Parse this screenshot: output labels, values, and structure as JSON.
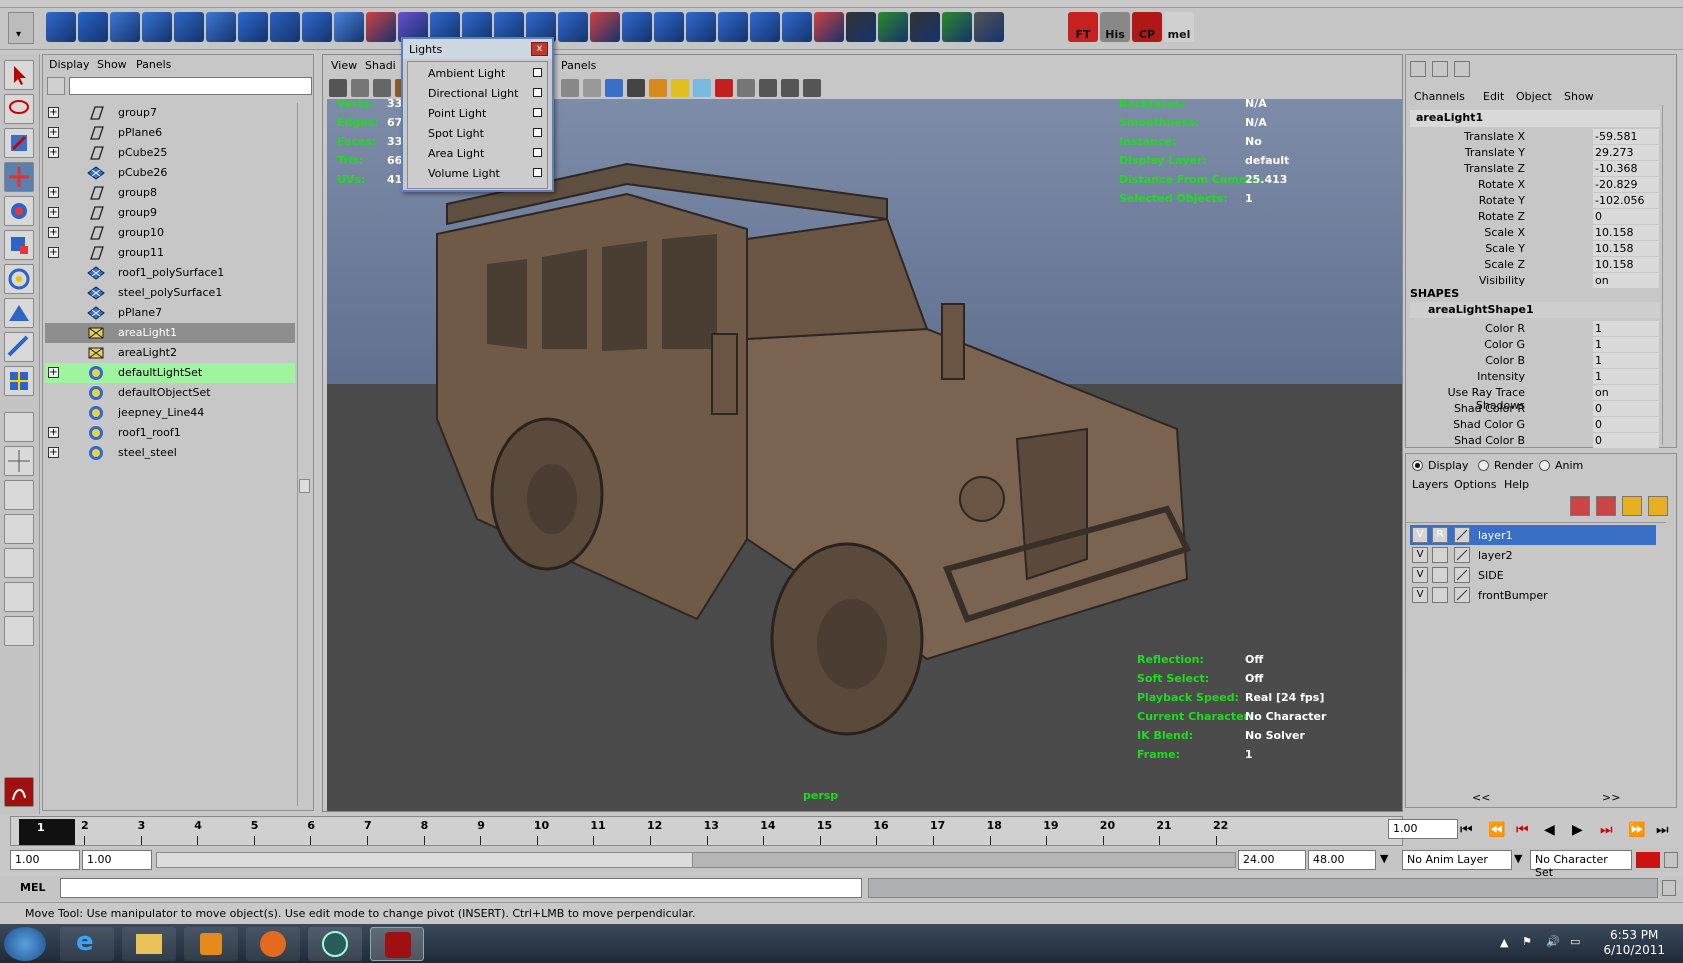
{
  "shelf": {
    "buttons": [
      {
        "label": "FT"
      },
      {
        "label": "His"
      },
      {
        "label": "CP"
      },
      {
        "label": "mel"
      }
    ]
  },
  "outliner": {
    "menu": [
      "Display",
      "Show",
      "Panels"
    ],
    "items": [
      {
        "name": "group7",
        "icon": "transform-icon",
        "expandable": true
      },
      {
        "name": "pPlane6",
        "icon": "transform-icon",
        "expandable": true
      },
      {
        "name": "pCube25",
        "icon": "transform-icon",
        "expandable": true
      },
      {
        "name": "pCube26",
        "icon": "mesh-icon",
        "expandable": false
      },
      {
        "name": "group8",
        "icon": "transform-icon",
        "expandable": true
      },
      {
        "name": "group9",
        "icon": "transform-icon",
        "expandable": true
      },
      {
        "name": "group10",
        "icon": "transform-icon",
        "expandable": true
      },
      {
        "name": "group11",
        "icon": "transform-icon",
        "expandable": true
      },
      {
        "name": "roof1_polySurface1",
        "icon": "mesh-icon",
        "expandable": false
      },
      {
        "name": "steel_polySurface1",
        "icon": "mesh-icon",
        "expandable": false
      },
      {
        "name": "pPlane7",
        "icon": "mesh-icon",
        "expandable": false
      },
      {
        "name": "areaLight1",
        "icon": "area-light-icon",
        "expandable": false,
        "state": "selected"
      },
      {
        "name": "areaLight2",
        "icon": "area-light-icon",
        "expandable": false
      },
      {
        "name": "defaultLightSet",
        "icon": "set-icon",
        "expandable": true,
        "state": "highlight"
      },
      {
        "name": "defaultObjectSet",
        "icon": "set-icon",
        "expandable": false
      },
      {
        "name": "jeepney_Line44",
        "icon": "set-icon",
        "expandable": false
      },
      {
        "name": "roof1_roof1",
        "icon": "set-icon",
        "expandable": true
      },
      {
        "name": "steel_steel",
        "icon": "set-icon",
        "expandable": true
      }
    ]
  },
  "viewport": {
    "menu": [
      "View",
      "Shadi",
      "Panels"
    ],
    "camera": "persp",
    "hud_top_left": [
      {
        "label": "Verts:",
        "value": "33"
      },
      {
        "label": "Edges:",
        "value": "67"
      },
      {
        "label": "Faces:",
        "value": "33"
      },
      {
        "label": "Tris:",
        "value": "66"
      },
      {
        "label": "UVs:",
        "value": "41"
      }
    ],
    "hud_top_right": [
      {
        "label": "Backfaces:",
        "value": "N/A"
      },
      {
        "label": "Smoothness:",
        "value": "N/A"
      },
      {
        "label": "Instance:",
        "value": "No"
      },
      {
        "label": "Display Layer:",
        "value": "default"
      },
      {
        "label": "Distance From Camera:",
        "value": "25.413"
      },
      {
        "label": "Selected Objects:",
        "value": "1"
      }
    ],
    "hud_bottom_right": [
      {
        "label": "Reflection:",
        "value": "Off"
      },
      {
        "label": "Soft Select:",
        "value": "Off"
      },
      {
        "label": "Playback Speed:",
        "value": "Real [24 fps]"
      },
      {
        "label": "Current Character:",
        "value": "No Character"
      },
      {
        "label": "IK Blend:",
        "value": "No Solver"
      },
      {
        "label": "Frame:",
        "value": "1"
      }
    ]
  },
  "lights_menu": {
    "title": "Lights",
    "close": "x",
    "items": [
      "Ambient Light",
      "Directional Light",
      "Point Light",
      "Spot Light",
      "Area Light",
      "Volume Light"
    ]
  },
  "channel_box": {
    "menu": [
      "Channels",
      "Edit",
      "Object",
      "Show"
    ],
    "node": "areaLight1",
    "attrs": [
      {
        "name": "Translate X",
        "value": "-59.581"
      },
      {
        "name": "Translate Y",
        "value": "29.273"
      },
      {
        "name": "Translate Z",
        "value": "-10.368"
      },
      {
        "name": "Rotate X",
        "value": "-20.829"
      },
      {
        "name": "Rotate Y",
        "value": "-102.056"
      },
      {
        "name": "Rotate Z",
        "value": "0"
      },
      {
        "name": "Scale X",
        "value": "10.158"
      },
      {
        "name": "Scale Y",
        "value": "10.158"
      },
      {
        "name": "Scale Z",
        "value": "10.158"
      },
      {
        "name": "Visibility",
        "value": "on"
      }
    ],
    "shapes_header": "SHAPES",
    "shape_node": "areaLightShape1",
    "shape_attrs": [
      {
        "name": "Color R",
        "value": "1"
      },
      {
        "name": "Color G",
        "value": "1"
      },
      {
        "name": "Color B",
        "value": "1"
      },
      {
        "name": "Intensity",
        "value": "1"
      },
      {
        "name": "Use Ray Trace Shadows",
        "value": "on"
      },
      {
        "name": "Shad Color R",
        "value": "0"
      },
      {
        "name": "Shad Color G",
        "value": "0"
      },
      {
        "name": "Shad Color B",
        "value": "0"
      }
    ]
  },
  "layer_editor": {
    "modes": [
      "Display",
      "Render",
      "Anim"
    ],
    "selected_mode": "Display",
    "menu": [
      "Layers",
      "Options",
      "Help"
    ],
    "layers": [
      {
        "v": "V",
        "r": "R",
        "name": "layer1",
        "selected": true
      },
      {
        "v": "V",
        "r": "",
        "name": "layer2",
        "selected": false
      },
      {
        "v": "V",
        "r": "",
        "name": "SIDE",
        "selected": false
      },
      {
        "v": "V",
        "r": "",
        "name": "frontBumper",
        "selected": false
      }
    ],
    "nav_left": "<<",
    "nav_right": ">>"
  },
  "timeline": {
    "current_frame": "1",
    "ticks": [
      "1",
      "2",
      "3",
      "4",
      "5",
      "6",
      "7",
      "8",
      "9",
      "10",
      "11",
      "12",
      "13",
      "14",
      "15",
      "16",
      "17",
      "18",
      "19",
      "20",
      "21",
      "22"
    ],
    "current_time_field": "1.00"
  },
  "range": {
    "start": "1.00",
    "playback_start": "1.00",
    "playback_end": "24.00",
    "end": "48.00",
    "anim_layer": "No Anim Layer",
    "character_set": "No Character Set"
  },
  "mel": {
    "label": "MEL",
    "value": ""
  },
  "helpline": "Move Tool: Use manipulator to move object(s). Use edit mode to change pivot (INSERT). Ctrl+LMB to move perpendicular.",
  "taskbar": {
    "time": "6:53 PM",
    "date": "6/10/2011"
  },
  "colors": {
    "hud_green": "#1edc1e",
    "selection_blue": "#3a6fc8",
    "highlight_green": "#9ff59f"
  }
}
